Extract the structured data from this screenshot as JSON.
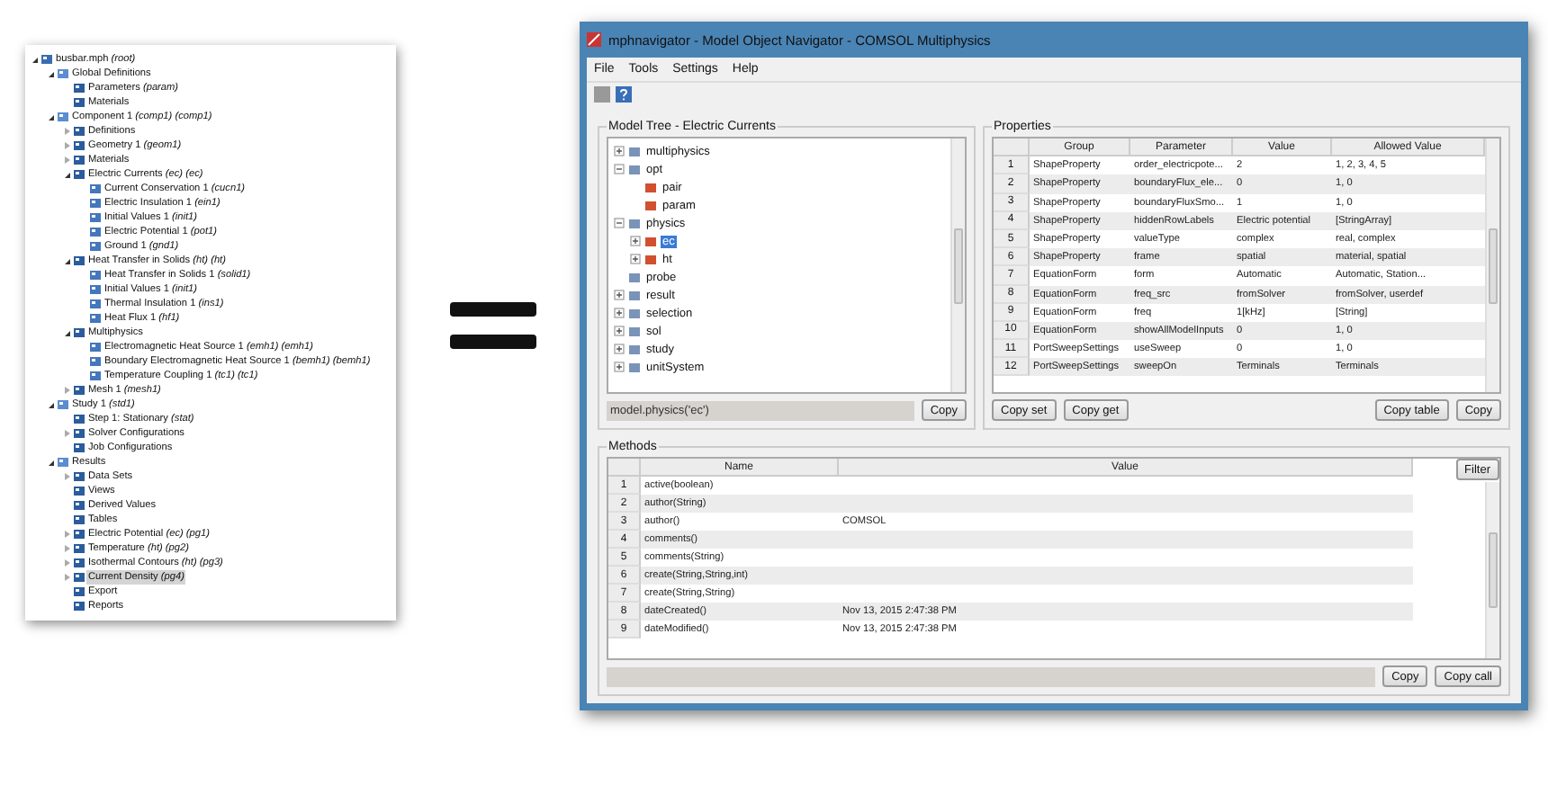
{
  "project_tree": [
    {
      "label": "busbar.mph *(root)*",
      "expanded": true,
      "selected": false,
      "children": [
        {
          "label": "Global Definitions",
          "expanded": true,
          "selected": false,
          "children": [
            {
              "label": "Parameters *(param)*",
              "selected": false
            },
            {
              "label": "Materials",
              "selected": false
            }
          ]
        },
        {
          "label": "Component 1 *(comp1) (comp1)*",
          "expanded": true,
          "selected": false,
          "children": [
            {
              "label": "Definitions",
              "expanded": false,
              "selected": false
            },
            {
              "label": "Geometry 1 *(geom1)*",
              "expanded": false,
              "selected": false
            },
            {
              "label": "Materials",
              "expanded": false,
              "selected": false
            },
            {
              "label": "Electric Currents *(ec) (ec)*",
              "expanded": true,
              "selected": false,
              "children": [
                {
                  "label": "Current Conservation 1 *(cucn1)*",
                  "selected": false
                },
                {
                  "label": "Electric Insulation 1 *(ein1)*",
                  "selected": false
                },
                {
                  "label": "Initial Values 1 *(init1)*",
                  "selected": false
                },
                {
                  "label": "Electric Potential 1 *(pot1)*",
                  "selected": false
                },
                {
                  "label": "Ground 1 *(gnd1)*",
                  "selected": false
                }
              ]
            },
            {
              "label": "Heat Transfer in Solids *(ht) (ht)*",
              "expanded": true,
              "selected": false,
              "children": [
                {
                  "label": "Heat Transfer in Solids 1 *(solid1)*",
                  "selected": false
                },
                {
                  "label": "Initial Values 1 *(init1)*",
                  "selected": false
                },
                {
                  "label": "Thermal Insulation 1 *(ins1)*",
                  "selected": false
                },
                {
                  "label": "Heat Flux 1 *(hf1)*",
                  "selected": false
                }
              ]
            },
            {
              "label": "Multiphysics",
              "expanded": true,
              "selected": false,
              "children": [
                {
                  "label": "Electromagnetic Heat Source 1 *(emh1) (emh1)*",
                  "selected": false
                },
                {
                  "label": "Boundary Electromagnetic Heat Source 1 *(bemh1) (bemh1)*",
                  "selected": false
                },
                {
                  "label": "Temperature Coupling 1 *(tc1) (tc1)*",
                  "selected": false
                }
              ]
            },
            {
              "label": "Mesh 1 *(mesh1)*",
              "expanded": false,
              "selected": false
            }
          ]
        },
        {
          "label": "Study 1 *(std1)*",
          "expanded": true,
          "selected": false,
          "children": [
            {
              "label": "Step 1: Stationary *(stat)*",
              "selected": false
            },
            {
              "label": "Solver Configurations",
              "expanded": false,
              "selected": false
            },
            {
              "label": "Job Configurations",
              "selected": false
            }
          ]
        },
        {
          "label": "Results",
          "expanded": true,
          "selected": false,
          "children": [
            {
              "label": "Data Sets",
              "expanded": false,
              "selected": false
            },
            {
              "label": "Views",
              "selected": false
            },
            {
              "label": "Derived Values",
              "selected": false
            },
            {
              "label": "Tables",
              "selected": false
            },
            {
              "label": "Electric Potential *(ec) (pg1)*",
              "expanded": false,
              "selected": false
            },
            {
              "label": "Temperature *(ht) (pg2)*",
              "expanded": false,
              "selected": false
            },
            {
              "label": "Isothermal Contours *(ht) (pg3)*",
              "expanded": false,
              "selected": false
            },
            {
              "label": "Current Density *(pg4)*",
              "expanded": false,
              "selected": true
            },
            {
              "label": "Export",
              "selected": false
            },
            {
              "label": "Reports",
              "selected": false
            }
          ]
        }
      ]
    }
  ],
  "equals_sign": true,
  "window": {
    "title": "mphnavigator - Model Object Navigator - COMSOL Multiphysics",
    "menu": [
      "File",
      "Tools",
      "Settings",
      "Help"
    ],
    "model_tree": {
      "title": "Model Tree - Electric Currents",
      "items": [
        {
          "label": "multiphysics",
          "expanded": false,
          "selected": false
        },
        {
          "label": "opt",
          "expanded": true,
          "selected": false,
          "children": [
            {
              "label": "pair",
              "selected": false
            },
            {
              "label": "param",
              "selected": false
            }
          ]
        },
        {
          "label": "physics",
          "expanded": true,
          "selected": false,
          "children": [
            {
              "label": "ec",
              "expanded": false,
              "selected": true
            },
            {
              "label": "ht",
              "expanded": false,
              "selected": false
            }
          ]
        },
        {
          "label": "probe",
          "selected": false
        },
        {
          "label": "result",
          "expanded": false,
          "selected": false
        },
        {
          "label": "selection",
          "expanded": false,
          "selected": false
        },
        {
          "label": "sol",
          "expanded": false,
          "selected": false
        },
        {
          "label": "study",
          "expanded": false,
          "selected": false
        },
        {
          "label": "unitSystem",
          "expanded": false,
          "selected": false
        }
      ],
      "path": "model.physics('ec')",
      "buttons": [
        "Copy"
      ]
    },
    "properties": {
      "title": "Properties",
      "columns": [
        "",
        "Group",
        "Parameter",
        "Value",
        "Allowed Value"
      ],
      "rows": [
        [
          "1",
          "ShapeProperty",
          "order_electricpote...",
          "2",
          "1, 2, 3, 4, 5"
        ],
        [
          "2",
          "ShapeProperty",
          "boundaryFlux_ele...",
          "0",
          "1, 0"
        ],
        [
          "3",
          "ShapeProperty",
          "boundaryFluxSmo...",
          "1",
          "1, 0"
        ],
        [
          "4",
          "ShapeProperty",
          "hiddenRowLabels",
          "Electric potential",
          "[StringArray]"
        ],
        [
          "5",
          "ShapeProperty",
          "valueType",
          "complex",
          "real, complex"
        ],
        [
          "6",
          "ShapeProperty",
          "frame",
          "spatial",
          "material, spatial"
        ],
        [
          "7",
          "EquationForm",
          "form",
          "Automatic",
          "Automatic, Station..."
        ],
        [
          "8",
          "EquationForm",
          "freq_src",
          "fromSolver",
          "fromSolver, userdef"
        ],
        [
          "9",
          "EquationForm",
          "freq",
          "1[kHz]",
          "[String]"
        ],
        [
          "10",
          "EquationForm",
          "showAllModelInputs",
          "0",
          "1, 0"
        ],
        [
          "11",
          "PortSweepSettings",
          "useSweep",
          "0",
          "1, 0"
        ],
        [
          "12",
          "PortSweepSettings",
          "sweepOn",
          "Terminals",
          "Terminals"
        ]
      ],
      "buttons_left": [
        "Copy set",
        "Copy get"
      ],
      "buttons_right": [
        "Copy table",
        "Copy"
      ]
    },
    "methods": {
      "title": "Methods",
      "filter": "Filter",
      "columns": [
        "",
        "Name",
        "Value"
      ],
      "rows": [
        [
          "1",
          "active(boolean)",
          ""
        ],
        [
          "2",
          "author(String)",
          ""
        ],
        [
          "3",
          "author()",
          "COMSOL"
        ],
        [
          "4",
          "comments()",
          ""
        ],
        [
          "5",
          "comments(String)",
          ""
        ],
        [
          "6",
          "create(String,String,int)",
          ""
        ],
        [
          "7",
          "create(String,String)",
          ""
        ],
        [
          "8",
          "dateCreated()",
          "Nov 13, 2015 2:47:38 PM"
        ],
        [
          "9",
          "dateModified()",
          "Nov 13, 2015 2:47:38 PM"
        ]
      ],
      "buttons": [
        "Copy",
        "Copy call"
      ]
    }
  }
}
